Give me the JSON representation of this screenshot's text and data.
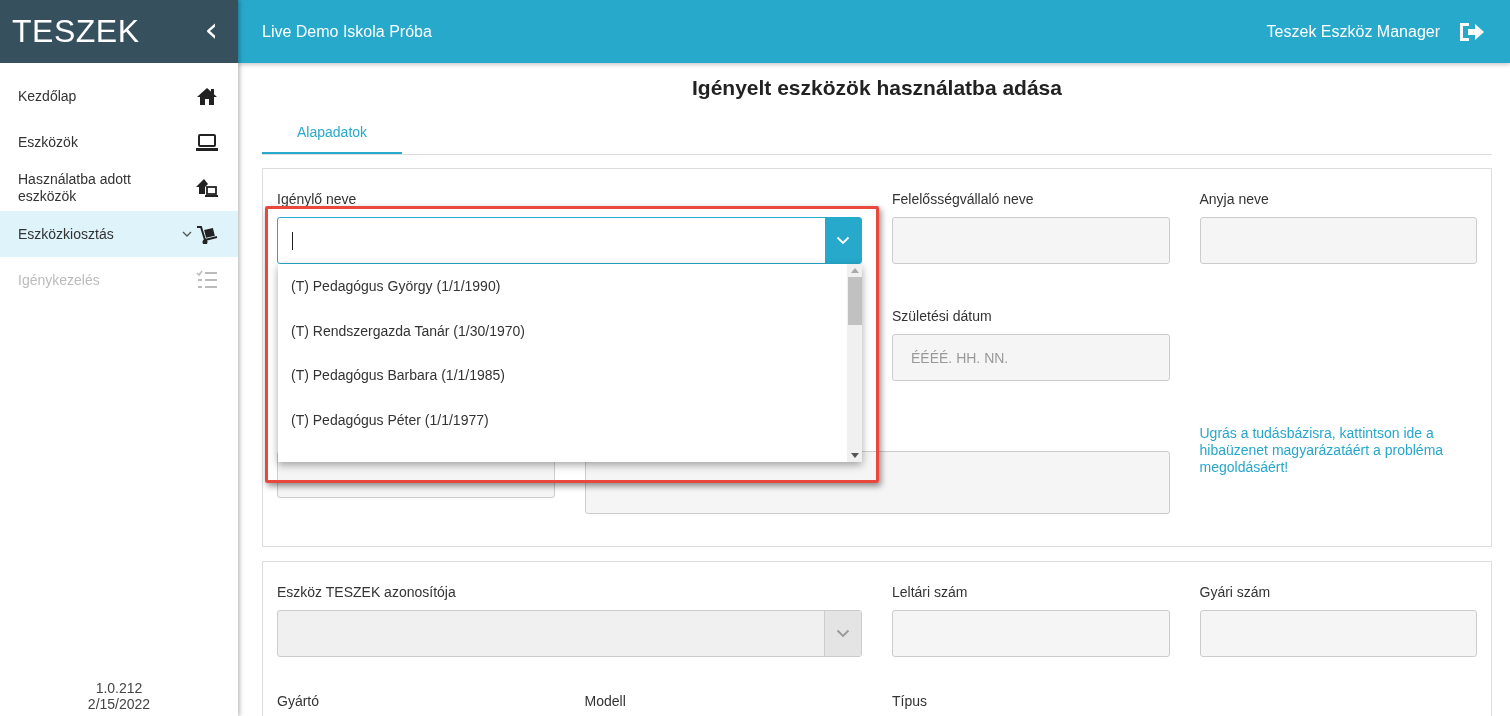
{
  "sidebar": {
    "logo": "TESZEK",
    "collapse_glyph": "‹",
    "items": [
      {
        "label": "Kezdőlap",
        "kind": "home",
        "selected": false,
        "disabled": false,
        "expandable": false
      },
      {
        "label": "Eszközök",
        "kind": "laptop",
        "selected": false,
        "disabled": false,
        "expandable": false
      },
      {
        "label": "Használatba adott eszközök",
        "kind": "house-laptop",
        "selected": false,
        "disabled": false,
        "expandable": false
      },
      {
        "label": "Eszközkiosztás",
        "kind": "hand-truck",
        "selected": true,
        "disabled": false,
        "expandable": true
      },
      {
        "label": "Igénykezelés",
        "kind": "checklist",
        "selected": false,
        "disabled": true,
        "expandable": false
      }
    ],
    "version": "1.0.212",
    "date": "2/15/2022"
  },
  "topbar": {
    "school": "Live Demo Iskola Próba",
    "app_name": "Teszek Eszköz Manager"
  },
  "page": {
    "title": "Igényelt eszközök használatba adása",
    "tabs": [
      {
        "label": "Alapadatok",
        "selected": true
      }
    ]
  },
  "panels": [
    {
      "fields": [
        {
          "kind": "combobox",
          "label": "Igénylő neve",
          "disabled": false,
          "open": true,
          "highlighted": true,
          "options": [
            "(T) Pedagógus György (1/1/1990)",
            "(T) Rendszergazda Tanár (1/30/1970)",
            "(T) Pedagógus Barbara (1/1/1985)",
            "(T) Pedagógus Péter (1/1/1977)"
          ]
        },
        {
          "kind": "text",
          "label": "Felelősségvállaló neve"
        },
        {
          "kind": "text",
          "label": "Anyja neve"
        },
        {
          "kind": "date",
          "label": "Születési dátum",
          "placeholder": "ÉÉÉÉ. HH. NN."
        },
        {
          "kind": "text"
        },
        {
          "kind": "textarea"
        },
        {
          "kind": "help",
          "text": "Ugrás a tudásbázisra, kattintson ide a hibaüzenet magyarázatáért a probléma megoldásáért!"
        }
      ]
    },
    {
      "fields": [
        {
          "kind": "combobox",
          "label": "Eszköz TESZEK azonosítója",
          "disabled": true,
          "open": false,
          "highlighted": false
        },
        {
          "kind": "text",
          "label": "Leltári szám"
        },
        {
          "kind": "text",
          "label": "Gyári szám"
        },
        {
          "kind": "label",
          "label": "Gyártó"
        },
        {
          "kind": "label",
          "label": "Modell"
        },
        {
          "kind": "label",
          "label": "Típus"
        }
      ]
    }
  ]
}
